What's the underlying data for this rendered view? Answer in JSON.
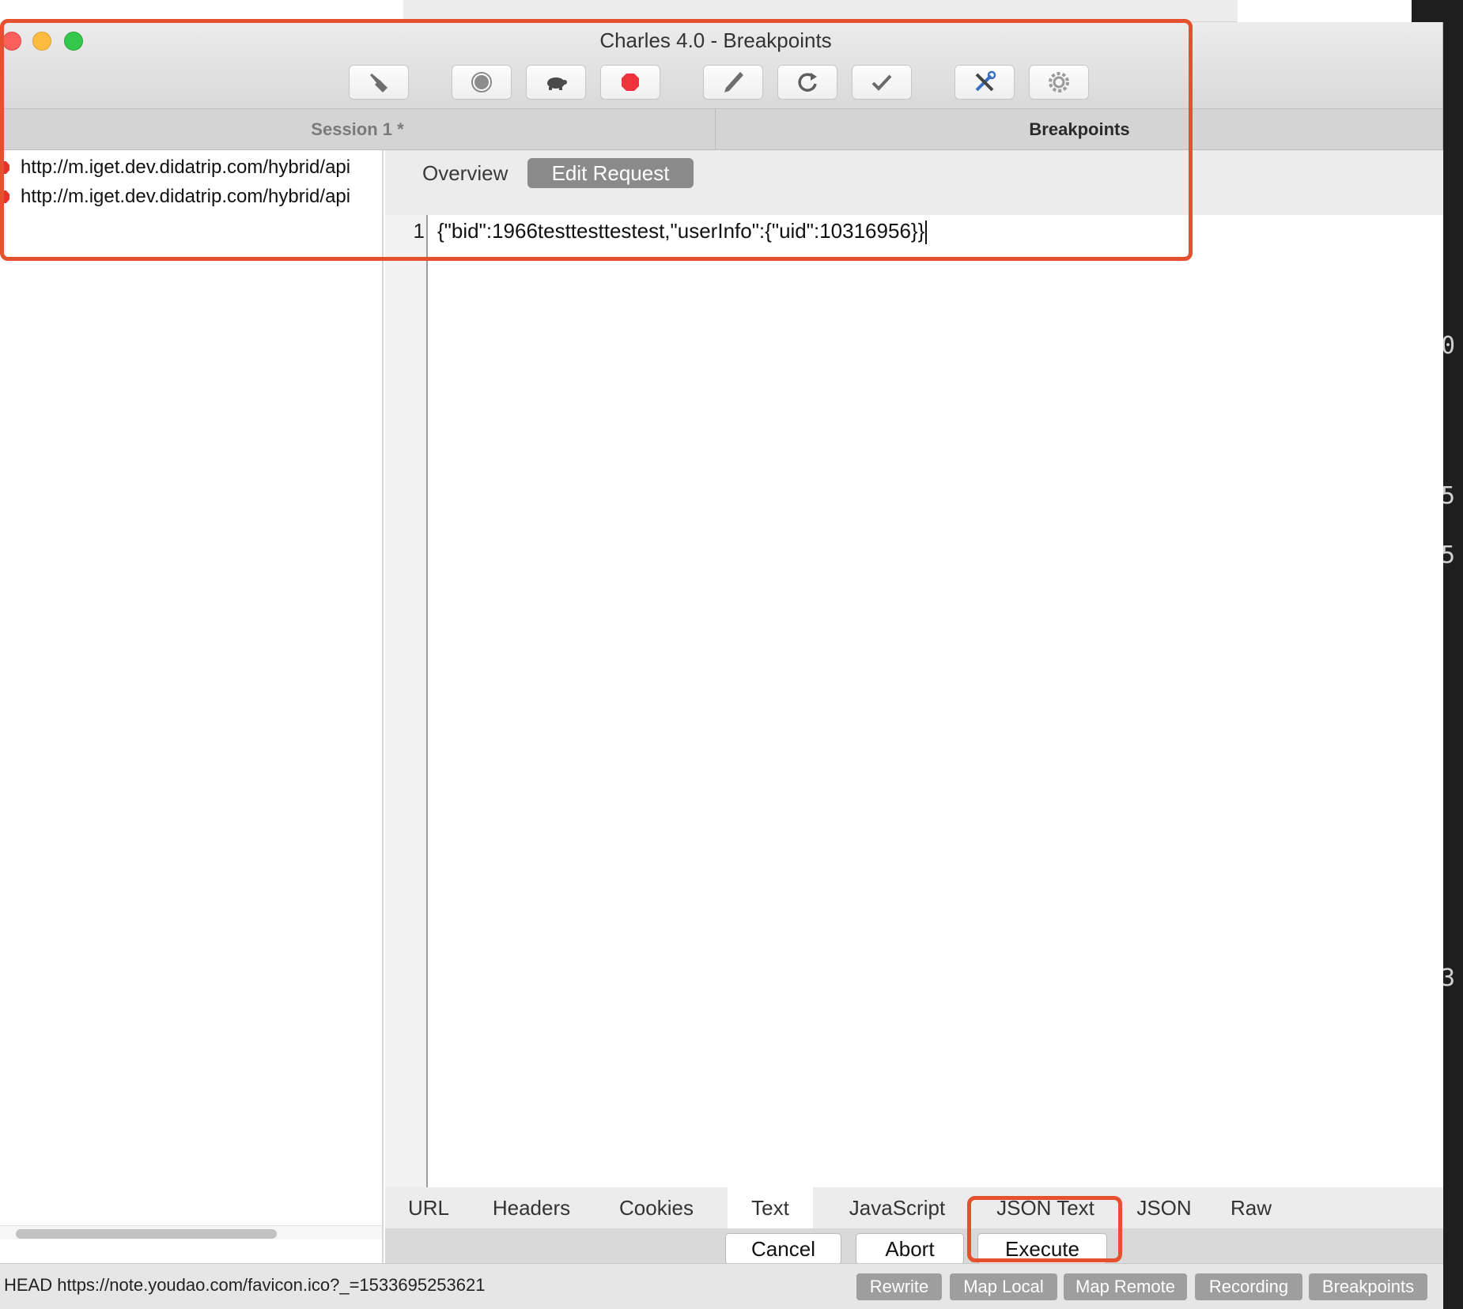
{
  "window": {
    "title": "Charles 4.0 - Breakpoints"
  },
  "toolbar": {
    "buttons": [
      {
        "name": "broom",
        "icon": "broom-icon"
      },
      {
        "name": "record",
        "icon": "record-icon"
      },
      {
        "name": "throttle",
        "icon": "turtle-icon"
      },
      {
        "name": "breakpoints",
        "icon": "stop-hexagon-icon"
      },
      {
        "name": "compose",
        "icon": "pen-icon"
      },
      {
        "name": "repeat",
        "icon": "refresh-icon"
      },
      {
        "name": "validate",
        "icon": "checkmark-icon"
      },
      {
        "name": "tools",
        "icon": "tools-icon"
      },
      {
        "name": "settings",
        "icon": "gear-icon"
      }
    ]
  },
  "tabs": {
    "session": "Session 1 *",
    "breakpoints": "Breakpoints"
  },
  "left_list": {
    "items": [
      "http://m.iget.dev.didatrip.com/hybrid/api",
      "http://m.iget.dev.didatrip.com/hybrid/api"
    ]
  },
  "subtabs": {
    "overview": "Overview",
    "edit_request": "Edit Request"
  },
  "editor": {
    "line_number": "1",
    "content": "{\"bid\":1966testtesttestest,\"userInfo\":{\"uid\":10316956}}"
  },
  "bottom_tabs": [
    "URL",
    "Headers",
    "Cookies",
    "Text",
    "JavaScript",
    "JSON Text",
    "JSON",
    "Raw"
  ],
  "active_bottom_tab": "Text",
  "actions": {
    "cancel": "Cancel",
    "abort": "Abort",
    "execute": "Execute"
  },
  "statusbar": {
    "text": "HEAD https://note.youdao.com/favicon.ico?_=1533695253621",
    "buttons": [
      "Rewrite",
      "Map Local",
      "Map Remote",
      "Recording",
      "Breakpoints"
    ]
  },
  "colors": {
    "annotation": "#e5502f",
    "breakpoint_red": "#e8332b",
    "active_subtab": "#8a8a8a"
  }
}
